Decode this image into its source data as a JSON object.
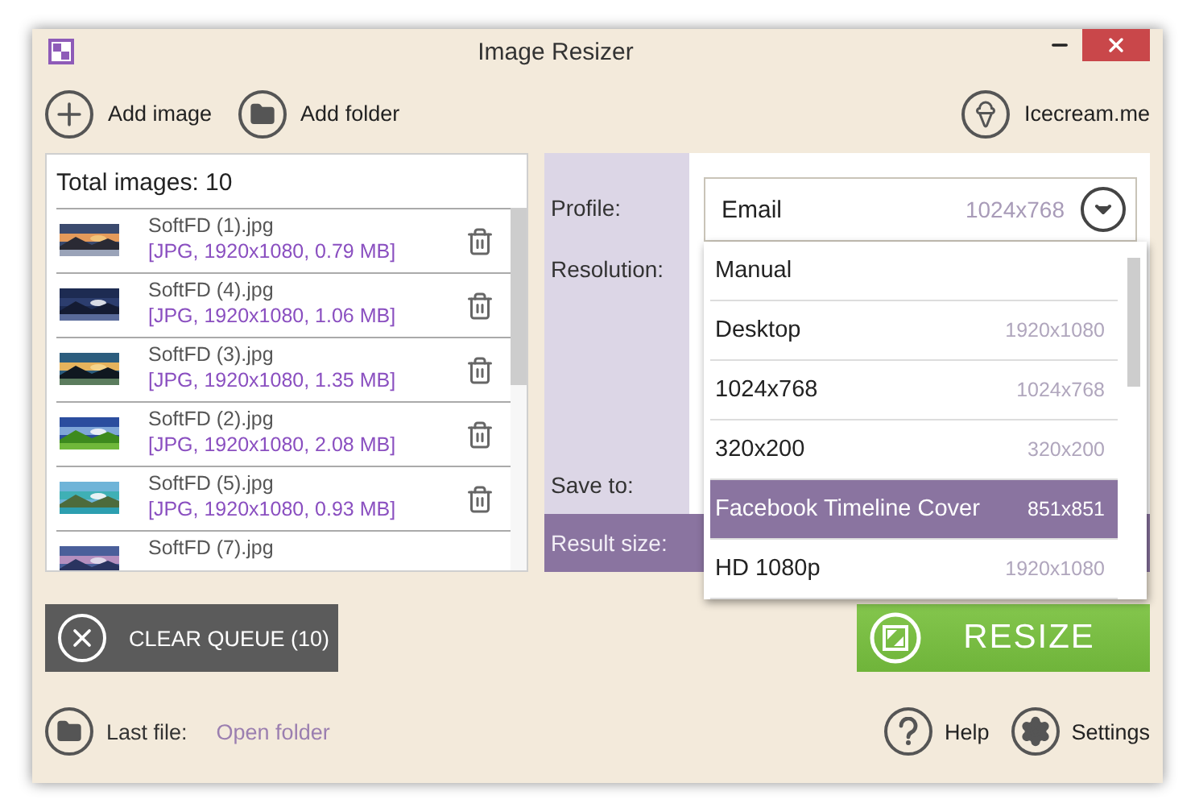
{
  "window": {
    "title": "Image Resizer"
  },
  "toolbar": {
    "add_image": "Add image",
    "add_folder": "Add folder",
    "brand_link": "Icecream.me"
  },
  "queue": {
    "total": "Total images: 10",
    "files": [
      {
        "name": "SoftFD (1).jpg",
        "details": "[JPG, 1920x1080, 0.79 MB]"
      },
      {
        "name": "SoftFD (4).jpg",
        "details": "[JPG, 1920x1080, 1.06 MB]"
      },
      {
        "name": "SoftFD (3).jpg",
        "details": "[JPG, 1920x1080, 1.35 MB]"
      },
      {
        "name": "SoftFD (2).jpg",
        "details": "[JPG, 1920x1080, 2.08 MB]"
      },
      {
        "name": "SoftFD (5).jpg",
        "details": "[JPG, 1920x1080, 0.93 MB]"
      },
      {
        "name": "SoftFD (7).jpg"
      }
    ]
  },
  "settings": {
    "labels": [
      "Profile:",
      "Resolution:",
      "Save to:"
    ],
    "result_label": "Result size:",
    "profile": {
      "value": "Email",
      "resolution": "1024x768",
      "expanded": true,
      "options": [
        {
          "name": "Manual",
          "selected": false
        },
        {
          "name": "Desktop",
          "resolution": "1920x1080",
          "selected": false
        },
        {
          "name": "1024x768",
          "resolution": "1024x768",
          "selected": false
        },
        {
          "name": "320x200",
          "resolution": "320x200",
          "selected": false
        },
        {
          "name": "Facebook Timeline Cover",
          "resolution": "851x851",
          "selected": true
        },
        {
          "name": "HD 1080p",
          "resolution": "1920x1080",
          "selected": false
        }
      ]
    }
  },
  "actions": {
    "clear": "CLEAR QUEUE (10)",
    "resize": "RESIZE"
  },
  "footer": {
    "last_file_label": "Last file:",
    "open_folder": "Open folder",
    "help": "Help",
    "settings": "Settings"
  }
}
